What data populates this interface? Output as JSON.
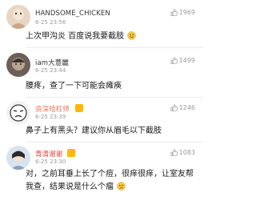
{
  "comments": [
    {
      "username": "HANDSOME_CHICKEN",
      "timestamp": "6-25 23:56",
      "likes": "1969",
      "text": "上次甲沟炎 百度说我要截肢",
      "emoji": "smiley-face-icon"
    },
    {
      "username": "iam大薏麗",
      "timestamp": "6-25 23:44",
      "likes": "1499",
      "text": "腰疼，查了一下可能会瘫痪"
    },
    {
      "username": "资深哈杠师",
      "timestamp": "6-25 23:39",
      "likes": "1246",
      "text": "鼻子上有黑头？建议你从眉毛以下截肢"
    },
    {
      "username": "青清谢谢",
      "timestamp": "6-25 23:30",
      "likes": "1083",
      "text": "对，之前耳垂上长了个痘，很痒很痒，让室友帮我查，结果说是什么个瘤",
      "emoji": "sad-face-icon"
    }
  ],
  "colors": {
    "username": "#333333",
    "username_orange": "#eb7350",
    "username_red": "#e0443d",
    "meta": "#9a9a9a",
    "text": "#1a1a1a",
    "badge": "#ffb800"
  },
  "icons": {
    "like": "thumbs-up-icon"
  }
}
